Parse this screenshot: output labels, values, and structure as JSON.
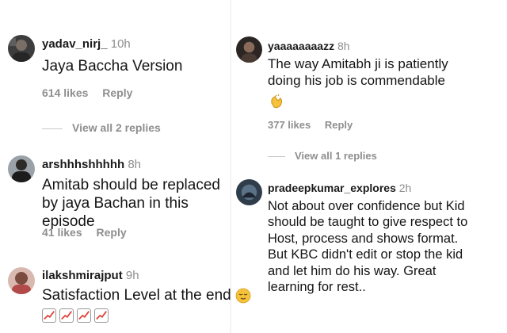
{
  "left_column": [
    {
      "username": "yadav_nirj_",
      "time": "10h",
      "text": "Jaya Baccha Version",
      "likes": "614 likes",
      "reply_label": "Reply",
      "view_replies": "View all 2 replies"
    },
    {
      "username": "arshhhshhhhh",
      "time": "8h",
      "text": "Amitab should be replaced by jaya Bachan in this episode",
      "likes": "41 likes",
      "reply_label": "Reply"
    },
    {
      "username": "ilakshmirajput",
      "time": "9h",
      "text": "Satisfaction Level at the end",
      "emoji_icon": "relieved-face-icon",
      "trend_icons": [
        "chart-increasing-icon",
        "chart-increasing-icon",
        "chart-increasing-icon",
        "chart-increasing-icon"
      ]
    }
  ],
  "right_column": [
    {
      "username": "yaaaaaaaazz",
      "time": "8h",
      "text": "The way Amitabh ji is patiently doing his job is commendable",
      "emoji_icon": "clapping-hands-icon",
      "likes": "377 likes",
      "reply_label": "Reply",
      "view_replies": "View all 1 replies"
    },
    {
      "username": "pradeepkumar_explores",
      "time": "2h",
      "text": "Not about over confidence but Kid should be taught to give respect to Host, process and shows format. But KBC didn't edit or stop the kid and let him do his way. Great learning for rest.."
    }
  ],
  "colors": {
    "text": "#141414",
    "secondary": "#8e8e8e",
    "emoji_yellow": "#f5c33b",
    "trend_red": "#e0423a"
  }
}
